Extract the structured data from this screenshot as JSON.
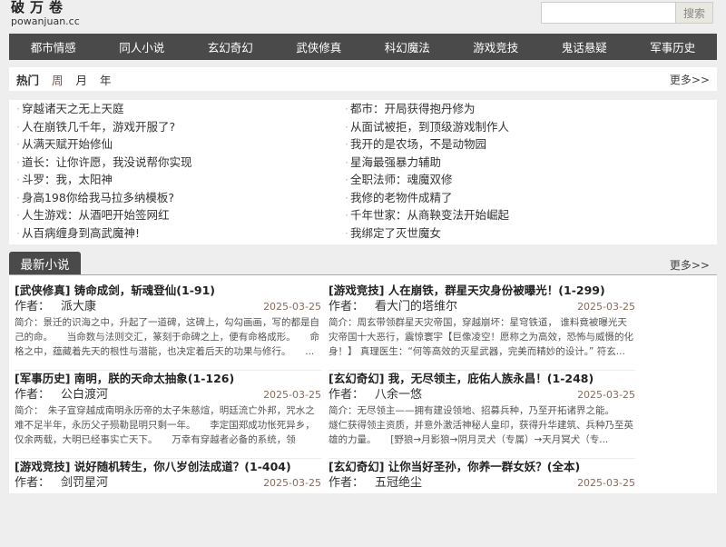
{
  "logo": {
    "name": "破万卷",
    "domain": "powanjuan.cc"
  },
  "search": {
    "placeholder": "",
    "button": "搜索"
  },
  "nav": [
    "都市情感",
    "同人小说",
    "玄幻奇幻",
    "武侠修真",
    "科幻魔法",
    "游戏竞技",
    "鬼话悬疑",
    "军事历史"
  ],
  "hot": {
    "label": "热门",
    "tabs": [
      "周",
      "月",
      "年"
    ],
    "active": "周",
    "more": "更多>>",
    "left": [
      "穿越诸天之无上天庭",
      "人在崩铁几千年，游戏开服了?",
      "从满天赋开始修仙",
      "道长：让你许愿，我没说帮你实现",
      "斗罗：我，太阳神",
      "身高198你给我马拉多纳模板?",
      "人生游戏：从酒吧开始签网红",
      "从百病缠身到高武魔神!"
    ],
    "right": [
      "都市：开局获得抱丹修为",
      "从面试被拒，到顶级游戏制作人",
      "我开的是农场，不是动物园",
      "星海最强暴力辅助",
      "全职法师：魂魔双修",
      "我修的老物件成精了",
      "千年世家：从商鞅变法开始崛起",
      "我绑定了灭世魔女"
    ]
  },
  "latest": {
    "tab": "最新小说",
    "more": "更多>>",
    "author_label": "作者：",
    "cards": [
      {
        "title": "[武侠修真] 铸命成剑，斩魂登仙(1-91)",
        "author": "派大康",
        "date": "2025-03-25",
        "intro": "简介：景迁的识海之中，升起了一道碑，这碑上，勾勾画画，写的都是自己的命。　　当命数与法则交汇，篆刻于命碑之上，便有命格成形。　　命格之中，蕴藏着先天的根性与潜能，也决定着后天的功果与修行。　　..."
      },
      {
        "title": "[游戏竞技] 人在崩铁，群星天灾身份被曝光！(1-299)",
        "author": "看大门的塔维尔",
        "date": "2025-03-25",
        "intro": "简介：周玄带领群星天灾帝国，穿越崩坏：星穹铁道， 谁料竟被曝光天灾帝国十大恶行，震惊寰宇【巨像凌空！愿称之为高效，恐怖与威慑的化身！】 真理医生：“何等高效的灭星武器，完美而精妙的设计。” 符玄..."
      },
      {
        "title": "[军事历史] 南明，朕的天命太抽象(1-126)",
        "author": "公白渡河",
        "date": "2025-03-25",
        "intro": "简介：　朱子宣穿越成南明永历帝的太子朱慈煊，明廷流亡外邦，咒水之难不足半年，永历父子殒勒昆明只剩一年。　　李定国郑成功怅死异乡，仅余两载，大明已经事实亡天下。　　万幸有穿越者必备的系统，领土、..."
      },
      {
        "title": "[玄幻奇幻] 我，无尽领主，庇佑人族永昌！(1-248)",
        "author": "八余一悠",
        "date": "2025-03-25",
        "intro": "简介：无尽领主——拥有建设领地、招募兵种，乃至开拓诸界之能。　　燧仁获得领主资质，并意外激活神秘人皇印，获得升华建筑、兵种乃至英雄的力量。　　[野狼→月影狼→阴月灵犬（专属）→天月冥犬（专..."
      },
      {
        "title": "[游戏竞技] 说好随机转生，你八岁创法成道？(1-404)",
        "author": "剑罚星河",
        "date": "2025-03-25",
        "intro": ""
      },
      {
        "title": "[玄幻奇幻] 让你当好圣孙，你养一群女妖？(全本)",
        "author": "五冠绝尘",
        "date": "2025-03-25",
        "intro": ""
      }
    ]
  }
}
